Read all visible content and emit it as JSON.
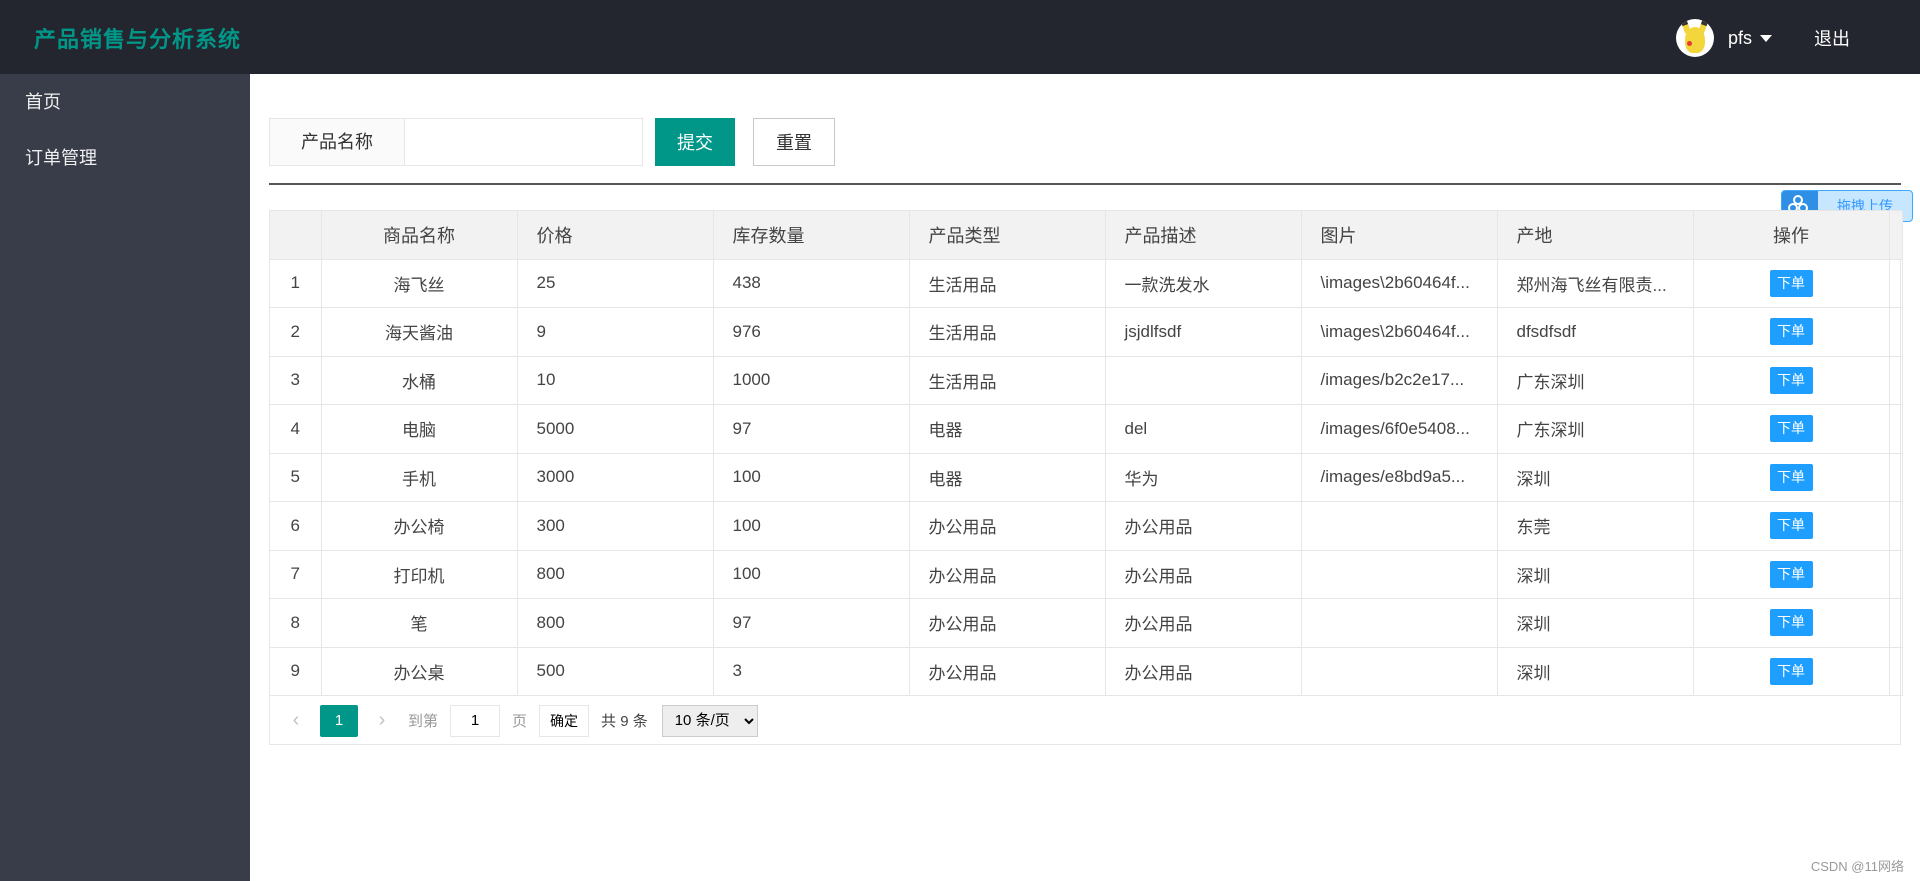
{
  "app": {
    "title": "产品销售与分析系统"
  },
  "user": {
    "name": "pfs",
    "logout": "退出"
  },
  "sidebar": {
    "items": [
      {
        "label": "首页"
      },
      {
        "label": "订单管理"
      }
    ]
  },
  "search": {
    "label": "产品名称",
    "value": "",
    "submit": "提交",
    "reset": "重置"
  },
  "upload": {
    "label": "拖拽上传"
  },
  "table": {
    "headers": [
      "",
      "商品名称",
      "价格",
      "库存数量",
      "产品类型",
      "产品描述",
      "图片",
      "产地",
      "操作"
    ],
    "action_label": "下单",
    "rows": [
      [
        "1",
        "海飞丝",
        "25",
        "438",
        "生活用品",
        "一款洗发水",
        "\\images\\2b60464f...",
        "郑州海飞丝有限责..."
      ],
      [
        "2",
        "海天酱油",
        "9",
        "976",
        "生活用品",
        "jsjdlfsdf",
        "\\images\\2b60464f...",
        "dfsdfsdf"
      ],
      [
        "3",
        "水桶",
        "10",
        "1000",
        "生活用品",
        "",
        "/images/b2c2e17...",
        "广东深圳"
      ],
      [
        "4",
        "电脑",
        "5000",
        "97",
        "电器",
        "del",
        "/images/6f0e5408...",
        "广东深圳"
      ],
      [
        "5",
        "手机",
        "3000",
        "100",
        "电器",
        "华为",
        "/images/e8bd9a5...",
        "深圳"
      ],
      [
        "6",
        "办公椅",
        "300",
        "100",
        "办公用品",
        "办公用品",
        "",
        "东莞"
      ],
      [
        "7",
        "打印机",
        "800",
        "100",
        "办公用品",
        "办公用品",
        "",
        "深圳"
      ],
      [
        "8",
        "笔",
        "800",
        "97",
        "办公用品",
        "办公用品",
        "",
        "深圳"
      ],
      [
        "9",
        "办公桌",
        "500",
        "3",
        "办公用品",
        "办公用品",
        "",
        "深圳"
      ]
    ]
  },
  "pager": {
    "current": "1",
    "goto_prefix": "到第",
    "goto_value": "1",
    "goto_suffix": "页",
    "confirm": "确定",
    "total": "共 9 条",
    "page_size": "10 条/页"
  },
  "watermark": "CSDN @11网络",
  "colors": {
    "header_bg": "#23262e",
    "sidebar_bg": "#393d49",
    "primary": "#009688",
    "action": "#1e9fff"
  }
}
